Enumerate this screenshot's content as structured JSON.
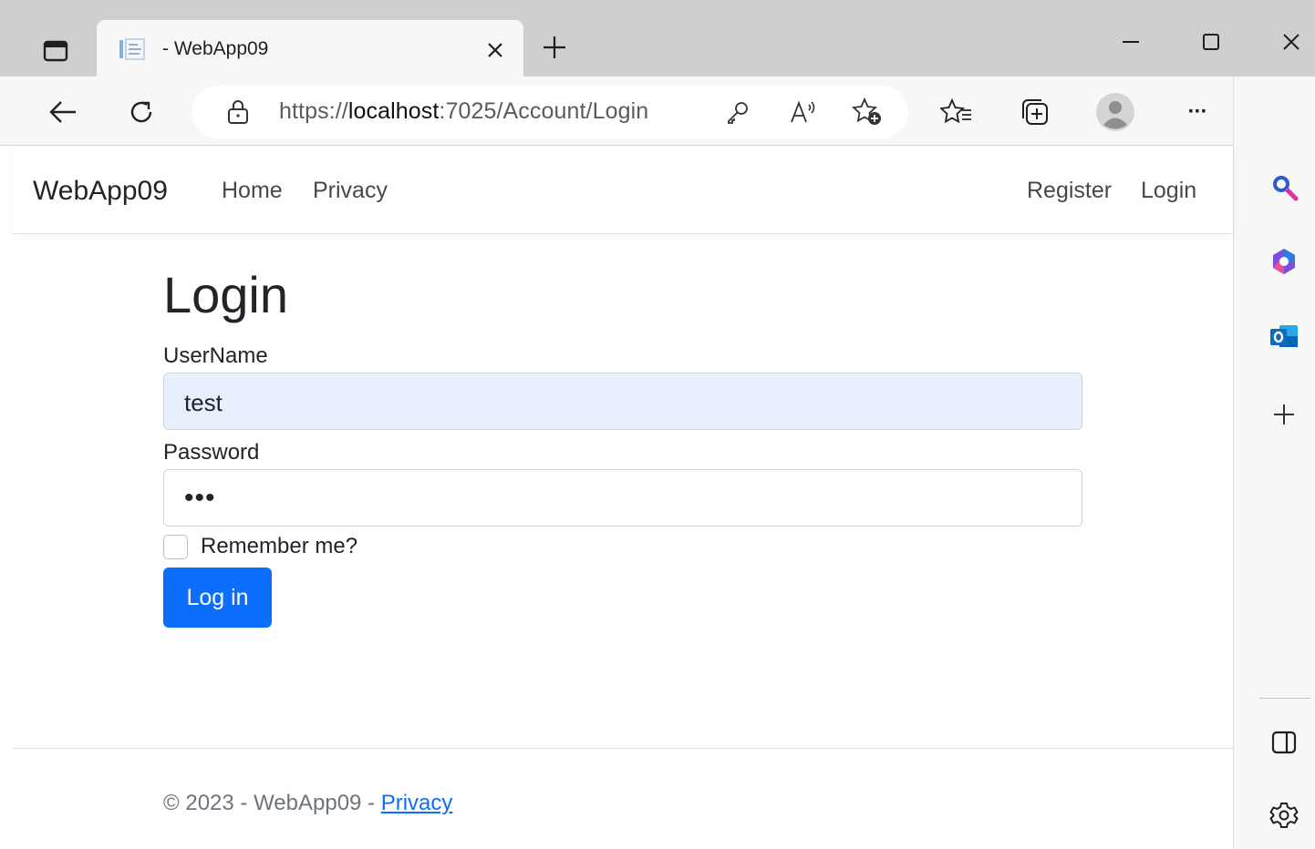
{
  "browser": {
    "tab": {
      "title": "- WebApp09",
      "close_glyph": "×"
    },
    "address_url": {
      "scheme": "https://",
      "host": "localhost",
      "rest": ":7025/Account/Login"
    },
    "icons": [
      "tab-actions-icon",
      "page-favicon-icon",
      "close-icon",
      "new-tab-icon",
      "minimize-icon",
      "maximize-icon",
      "window-close-icon",
      "back-icon",
      "refresh-icon",
      "lock-icon",
      "key-icon",
      "read-aloud-icon",
      "add-favorite-icon",
      "favorites-icon",
      "collections-icon",
      "profile-icon",
      "more-icon",
      "bing-icon",
      "search-icon",
      "copilot-icon",
      "outlook-icon",
      "add-icon",
      "sidebar-toggle-icon",
      "settings-icon"
    ],
    "more_glyph": "···"
  },
  "navbar": {
    "brand": "WebApp09",
    "links": [
      "Home",
      "Privacy"
    ],
    "right_links": [
      "Register",
      "Login"
    ]
  },
  "form": {
    "title": "Login",
    "username_label": "UserName",
    "username_value": "test",
    "password_label": "Password",
    "password_mask": "•••",
    "remember_label": "Remember me?",
    "remember_checked": false,
    "submit_label": "Log in"
  },
  "footer": {
    "text": "© 2023 - WebApp09 - ",
    "link": "Privacy"
  },
  "colors": {
    "primary": "#0d6efd",
    "autofill_bg": "#e8f0fe",
    "chrome_bg": "#cfcfcf",
    "toolbar_bg": "#f7f7f7"
  }
}
